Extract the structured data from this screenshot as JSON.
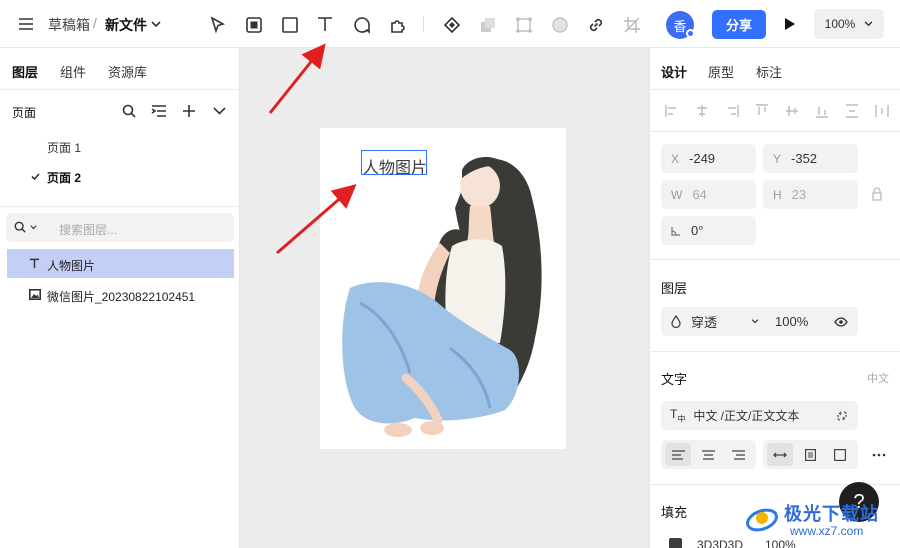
{
  "header": {
    "breadcrumb_drafts": "草稿箱",
    "breadcrumb_sep": "/",
    "file_name": "新文件",
    "avatar_text": "香",
    "share_label": "分享",
    "zoom": "100%"
  },
  "left": {
    "tabs": [
      "图层",
      "组件",
      "资源库"
    ],
    "pages_title": "页面",
    "pages": [
      {
        "label": "页面 1",
        "current": false
      },
      {
        "label": "页面 2",
        "current": true
      }
    ],
    "search_placeholder": "搜索图层...",
    "layers": [
      {
        "label": "人物图片",
        "type": "text",
        "selected": true
      },
      {
        "label": "微信图片_20230822102451",
        "type": "image",
        "selected": false
      }
    ]
  },
  "canvas": {
    "text_layer": "人物图片"
  },
  "right": {
    "tabs": [
      "设计",
      "原型",
      "标注"
    ],
    "x_label": "X",
    "x_value": "-249",
    "y_label": "Y",
    "y_value": "-352",
    "w_label": "W",
    "w_value": "64",
    "h_label": "H",
    "h_value": "23",
    "rotation": "0°",
    "layer_title": "图层",
    "blend_mode": "穿透",
    "opacity": "100%",
    "text_title": "文字",
    "text_lang_hint": "中文",
    "text_style": "中文 /正文/正文文本",
    "fill_title": "填充",
    "fill_hex": "3D3D3D",
    "fill_opacity": "100%",
    "fill_color": "#3D3D3D"
  },
  "watermark": {
    "site_name": "极光下载站",
    "site_url": "www.xz7.com",
    "help_label": "?"
  },
  "colors": {
    "accent": "#3370FF",
    "selection": "#C3CFF5",
    "arrow": "#E02020"
  }
}
